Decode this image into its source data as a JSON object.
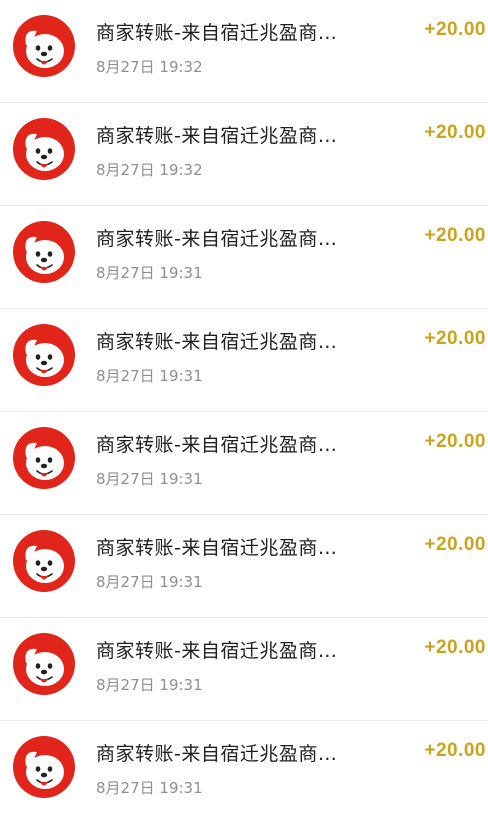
{
  "transactions": [
    {
      "title": "商家转账-来自宿迁兆盈商…",
      "time": "8月27日 19:32",
      "amount": "+20.00"
    },
    {
      "title": "商家转账-来自宿迁兆盈商…",
      "time": "8月27日 19:32",
      "amount": "+20.00"
    },
    {
      "title": "商家转账-来自宿迁兆盈商…",
      "time": "8月27日 19:31",
      "amount": "+20.00"
    },
    {
      "title": "商家转账-来自宿迁兆盈商…",
      "time": "8月27日 19:31",
      "amount": "+20.00"
    },
    {
      "title": "商家转账-来自宿迁兆盈商…",
      "time": "8月27日 19:31",
      "amount": "+20.00"
    },
    {
      "title": "商家转账-来自宿迁兆盈商…",
      "time": "8月27日 19:31",
      "amount": "+20.00"
    },
    {
      "title": "商家转账-来自宿迁兆盈商…",
      "time": "8月27日 19:31",
      "amount": "+20.00"
    },
    {
      "title": "商家转账-来自宿迁兆盈商…",
      "time": "8月27日 19:31",
      "amount": "+20.00"
    }
  ],
  "icon": "jd-dog-mascot-icon",
  "colors": {
    "amount": "#c9a41c",
    "brand_red": "#e1251b"
  }
}
